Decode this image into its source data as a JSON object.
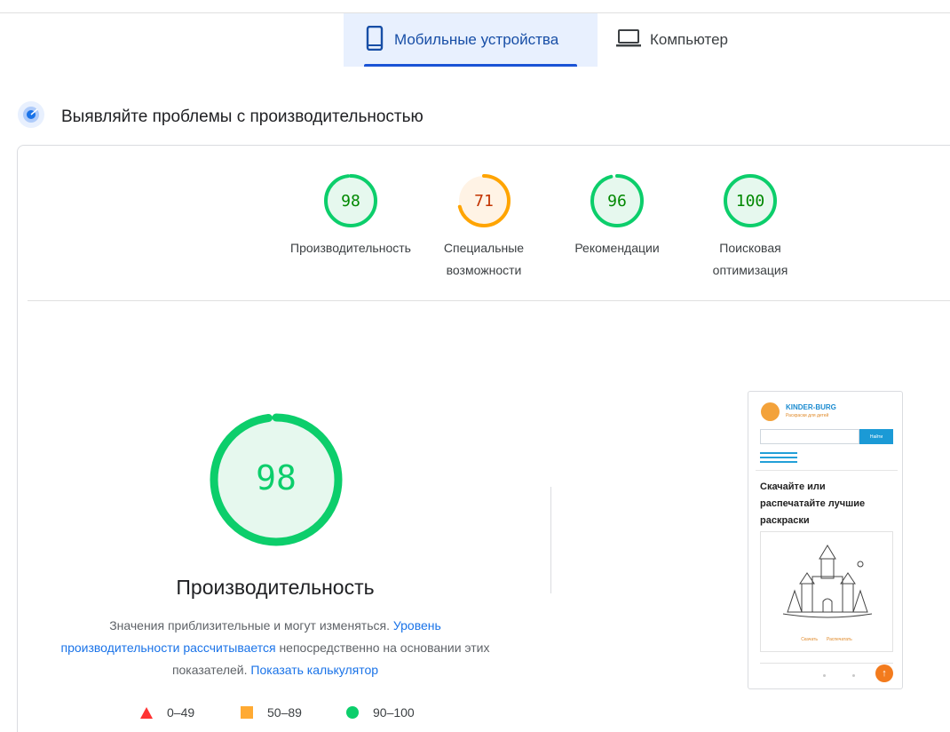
{
  "tabs": {
    "mobile": "Мобильные устройства",
    "desktop": "Компьютер"
  },
  "section": {
    "title": "Выявляйте проблемы с производительностью"
  },
  "scores": [
    {
      "label": "Производительность",
      "value": 98,
      "status": "pass",
      "color": "#0cce6b"
    },
    {
      "label": "Специальные возможности",
      "value": 71,
      "status": "average",
      "color": "#ffa400"
    },
    {
      "label": "Рекомендации",
      "value": 96,
      "status": "pass",
      "color": "#0cce6b"
    },
    {
      "label": "Поисковая оптимизация",
      "value": 100,
      "status": "pass",
      "color": "#0cce6b"
    }
  ],
  "performance": {
    "score": 98,
    "title": "Производительность",
    "desc_part1": "Значения приблизительные и могут изменяться.",
    "link1": "Уровень производительности рассчитывается",
    "desc_part2": "непосредственно на основании этих показателей.",
    "link2": "Показать калькулятор"
  },
  "legend": [
    {
      "range": "0–49",
      "shape": "triangle",
      "color": "#ff3333"
    },
    {
      "range": "50–89",
      "shape": "square",
      "color": "#ffaa33"
    },
    {
      "range": "90–100",
      "shape": "circle",
      "color": "#0cce6b"
    }
  ],
  "preview": {
    "brand": "KINDER-BURG",
    "tagline": "Раскраски для детей",
    "search_button": "Найти",
    "heading": "Скачайте или распечатайте лучшие раскраски",
    "download": "Скачать",
    "print": "Распечатать",
    "up_icon": "arrow-up-icon"
  },
  "colors": {
    "pass": "#0cce6b",
    "pass_text": "#008800",
    "average": "#ffa400",
    "average_text": "#c33300",
    "accent": "#1a73e8"
  }
}
